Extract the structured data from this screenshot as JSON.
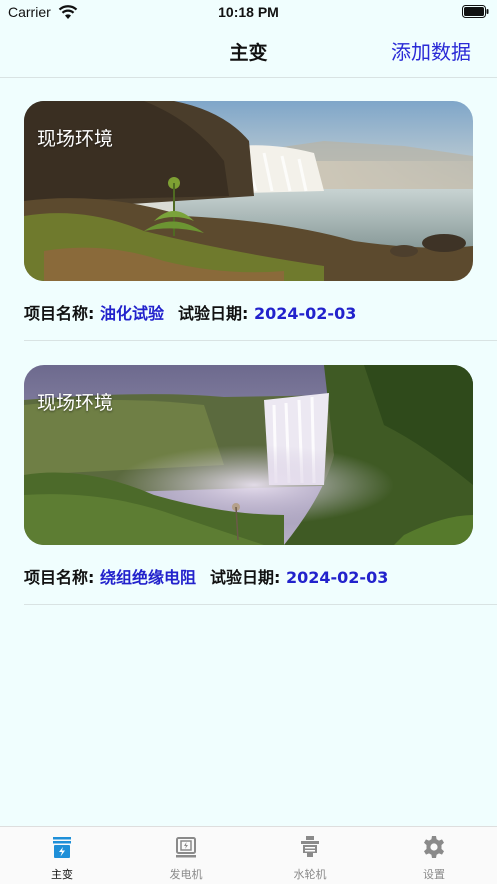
{
  "status_bar": {
    "carrier": "Carrier",
    "time": "10:18 PM"
  },
  "nav": {
    "title": "主变",
    "action_label": "添加数据"
  },
  "records": [
    {
      "photo_caption": "现场环境",
      "photo_icon": "waterfall-landscape-photo",
      "name_label": "项目名称:",
      "name_value": "油化试验",
      "date_label": "试验日期:",
      "date_value": "2024-02-03"
    },
    {
      "photo_caption": "现场环境",
      "photo_icon": "misty-waterfall-photo",
      "name_label": "项目名称:",
      "name_value": "绕组绝缘电阻",
      "date_label": "试验日期:",
      "date_value": "2024-02-03"
    }
  ],
  "tabs": [
    {
      "label": "主变",
      "icon": "transformer-icon",
      "active": true
    },
    {
      "label": "发电机",
      "icon": "generator-icon",
      "active": false
    },
    {
      "label": "水轮机",
      "icon": "turbine-icon",
      "active": false
    },
    {
      "label": "设置",
      "icon": "gear-icon",
      "active": false
    }
  ],
  "colors": {
    "background": "#f0fefe",
    "accent": "#2a2ad6",
    "value_text": "#2222cc",
    "active_tab": "#1e8fd8"
  }
}
